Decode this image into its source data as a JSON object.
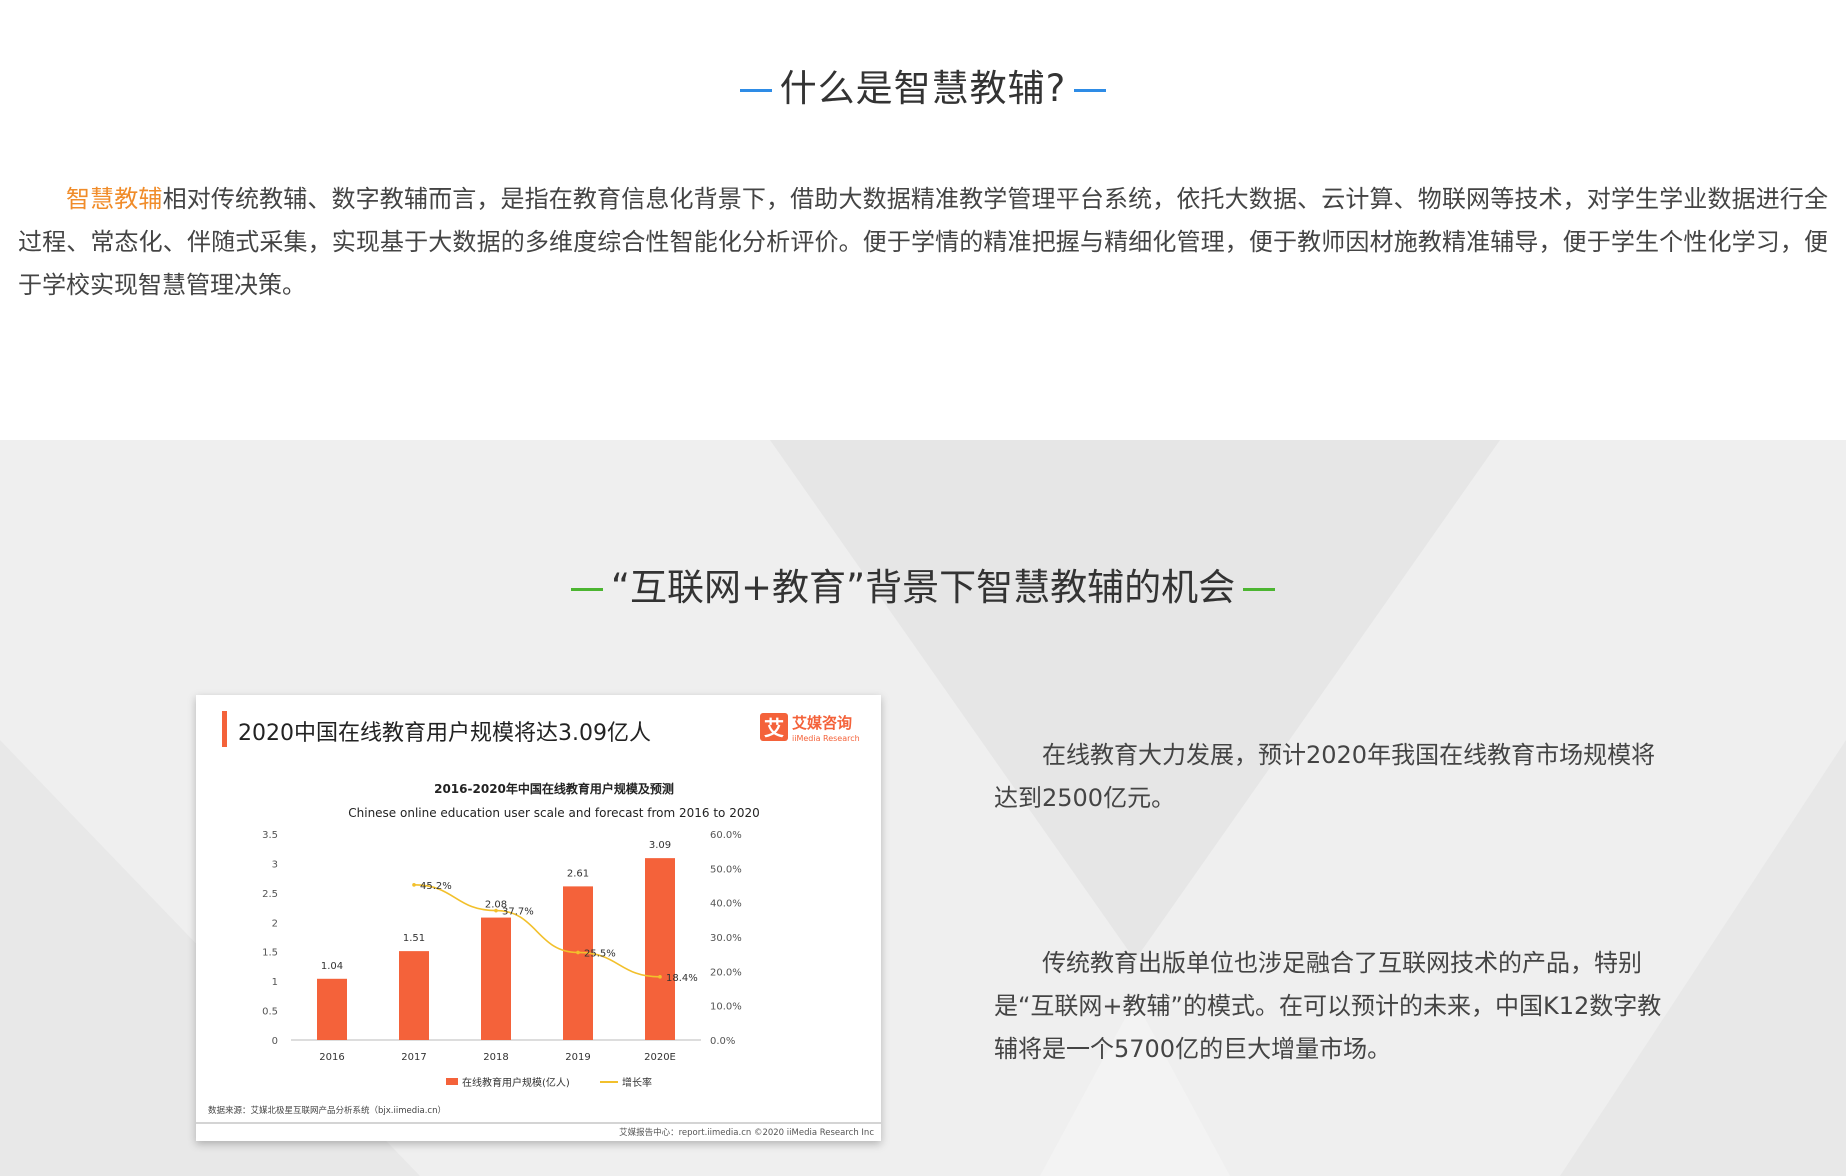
{
  "section1": {
    "title": "什么是智慧教辅?",
    "highlight": "智慧教辅",
    "body": "相对传统教辅、数字教辅而言，是指在教育信息化背景下，借助大数据精准教学管理平台系统，依托大数据、云计算、物联网等技术，对学生学业数据进行全过程、常态化、伴随式采集，实现基于大数据的多维度综合性智能化分析评价。便于学情的精准把握与精细化管理，便于教师因材施教精准辅导，便于学生个性化学习，便于学校实现智慧管理决策。"
  },
  "section2": {
    "title": "“互联网+教育”背景下智慧教辅的机会",
    "paragraph1": "在线教育大力发展，预计2020年我国在线教育市场规模将达到2500亿元。",
    "paragraph2": "传统教育出版单位也涉足融合了互联网技术的产品，特别是“互联网+教辅”的模式。在可以预计的未来，中国K12数字教辅将是一个5700亿的巨大增量市场。"
  },
  "colors": {
    "accent_blue": "#2e8ce6",
    "accent_green": "#4cb531",
    "highlight_orange": "#f08c2a",
    "bar": "#f4623a",
    "line": "#f2c02c"
  },
  "chart_card": {
    "headline": "2020中国在线教育用户规模将达3.09亿人",
    "logo_cn": "艾媒咨询",
    "logo_en": "iiMedia Research",
    "logo_char": "艾",
    "source": "数据来源：艾媒北极星互联网产品分析系统（bjx.iimedia.cn）",
    "footer": "艾媒报告中心：report.iimedia.cn ©2020 iiMedia Research Inc"
  },
  "chart_data": {
    "type": "bar",
    "title": "2016-2020年中国在线教育用户规模及预测",
    "subtitle": "Chinese online education user scale and forecast from 2016 to 2020",
    "categories": [
      "2016",
      "2017",
      "2018",
      "2019",
      "2020E"
    ],
    "series": [
      {
        "name": "在线教育用户规模(亿人)",
        "type": "bar",
        "axis": "left",
        "values": [
          1.04,
          1.51,
          2.08,
          2.61,
          3.09
        ],
        "labels": [
          "1.04",
          "1.51",
          "2.08",
          "2.61",
          "3.09"
        ]
      },
      {
        "name": "增长率",
        "type": "line",
        "axis": "right",
        "values": [
          null,
          45.2,
          37.7,
          25.5,
          18.4
        ],
        "labels": [
          "",
          "45.2%",
          "37.7%",
          "25.5%",
          "18.4%"
        ]
      }
    ],
    "yleft": {
      "range": [
        0,
        3.5
      ],
      "ticks": [
        "0",
        "0.5",
        "1",
        "1.5",
        "2",
        "2.5",
        "3",
        "3.5"
      ]
    },
    "yright": {
      "range": [
        0,
        60
      ],
      "ticks": [
        "0.0%",
        "10.0%",
        "20.0%",
        "30.0%",
        "40.0%",
        "50.0%",
        "60.0%"
      ]
    },
    "legend": "bottom",
    "grid": false
  }
}
